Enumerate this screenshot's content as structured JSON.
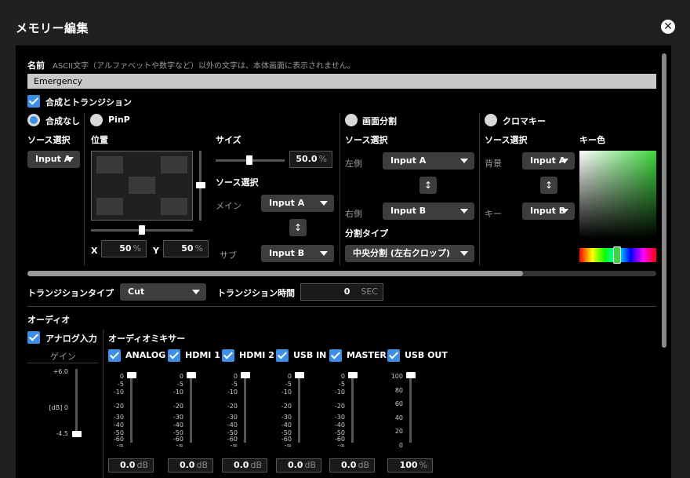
{
  "window": {
    "title": "メモリー編集",
    "close_icon": "close-icon"
  },
  "name_section": {
    "label": "名前",
    "hint": "ASCII文字（アルファベットや数字など）以外の文字は、本体画面に表示されません。",
    "value": "Emergency"
  },
  "compose": {
    "checkbox_label": "合成とトランジション",
    "checked": true
  },
  "modes": [
    {
      "label": "合成なし",
      "selected": true
    },
    {
      "label": "PinP",
      "selected": false
    },
    {
      "label": "画面分割",
      "selected": false
    },
    {
      "label": "クロマキー",
      "selected": false
    }
  ],
  "no_compose": {
    "source_label": "ソース選択",
    "source_value": "Input A"
  },
  "pinp": {
    "position_label": "位置",
    "x_label": "X",
    "x_value": "50",
    "x_unit": "%",
    "y_label": "Y",
    "y_value": "50",
    "y_unit": "%",
    "size_label": "サイズ",
    "size_value": "50.0",
    "size_unit": "%",
    "size_fraction": 0.5,
    "source_label": "ソース選択",
    "main_label": "メイン",
    "main_value": "Input A",
    "sub_label": "サブ",
    "sub_value": "Input B",
    "swap_icon": "swap-vertical-icon"
  },
  "split": {
    "source_label": "ソース選択",
    "left_label": "左側",
    "left_value": "Input A",
    "right_label": "右側",
    "right_value": "Input B",
    "type_label": "分割タイプ",
    "type_value": "中央分割 (左右クロップ)",
    "swap_icon": "swap-vertical-icon"
  },
  "chroma": {
    "source_label": "ソース選択",
    "key_color_label": "キー色",
    "bg_label": "背景",
    "bg_value": "Input A",
    "key_label": "キー",
    "key_value": "Input B",
    "key_color": "#3dd63d",
    "swap_icon": "swap-vertical-icon"
  },
  "transition": {
    "type_label": "トランジションタイプ",
    "type_value": "Cut",
    "time_label": "トランジション時間",
    "time_value": "0",
    "time_unit": "SEC"
  },
  "audio": {
    "title": "オーディオ",
    "analog_label": "アナログ入力",
    "analog_checked": true,
    "gain_label": "ゲイン",
    "gain_scale": [
      "+6.0",
      "[dB] 0",
      "-4.5"
    ],
    "gain_value": -4.5,
    "mixer_label": "オーディオミキサー",
    "db_scale": [
      "0",
      "-5",
      "-10",
      "-20",
      "-30",
      "-40",
      "-50",
      "-60",
      "-∞"
    ],
    "pct_scale": [
      "100",
      "80",
      "60",
      "40",
      "20",
      "0"
    ],
    "channels": [
      {
        "label": "ANALOG",
        "checked": true,
        "value": "0.0",
        "unit": "dB",
        "level_fraction": 1.0
      },
      {
        "label": "HDMI 1",
        "checked": true,
        "value": "0.0",
        "unit": "dB",
        "level_fraction": 1.0
      },
      {
        "label": "HDMI 2",
        "checked": true,
        "value": "0.0",
        "unit": "dB",
        "level_fraction": 1.0
      },
      {
        "label": "USB IN",
        "checked": true,
        "value": "0.0",
        "unit": "dB",
        "level_fraction": 1.0
      },
      {
        "label": "MASTER",
        "checked": true,
        "value": "0.0",
        "unit": "dB",
        "level_fraction": 1.0
      },
      {
        "label": "USB OUT",
        "checked": true,
        "value": "100",
        "unit": "%",
        "level_fraction": 1.0
      }
    ]
  }
}
